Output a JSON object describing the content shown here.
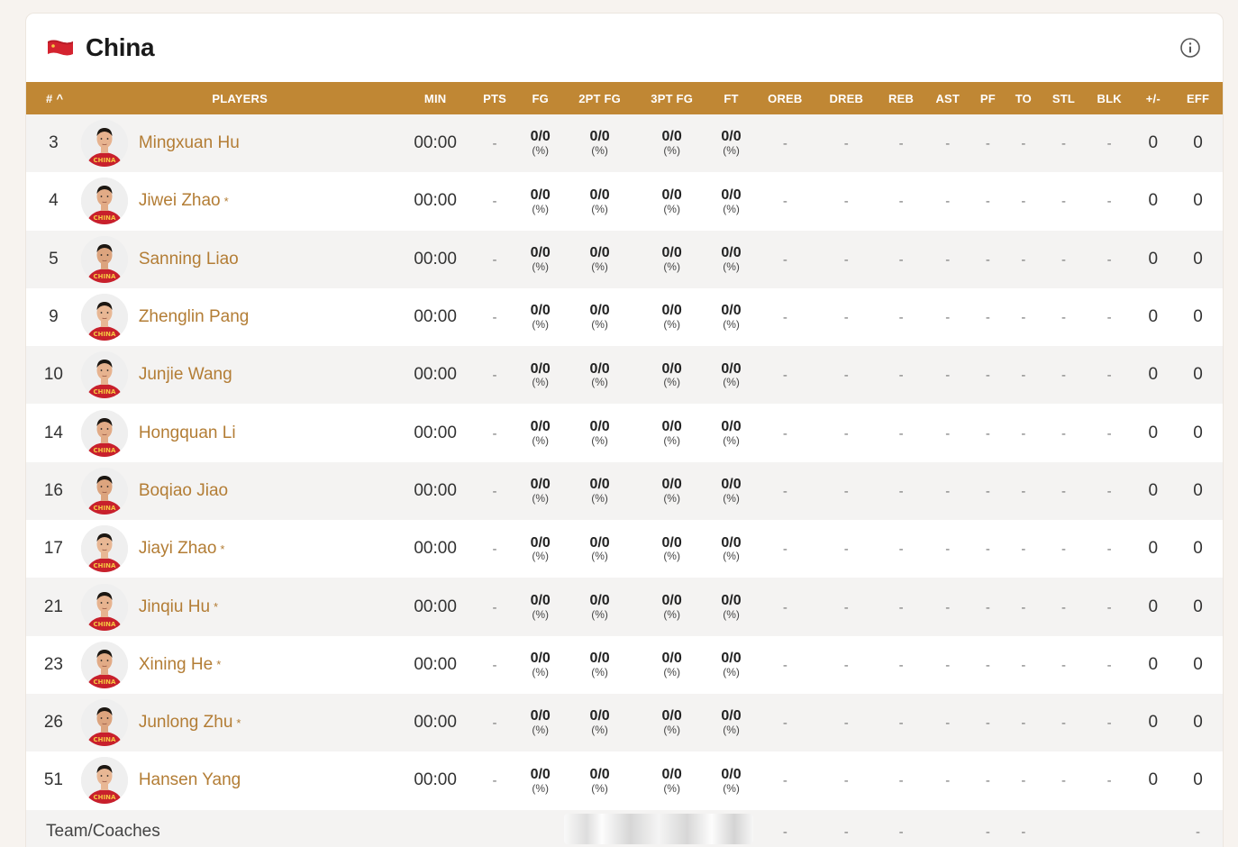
{
  "team": {
    "name": "China",
    "flag_color": "#d4232f",
    "flag_star_color": "#f5c842"
  },
  "columns": [
    "#",
    "PLAYERS",
    "MIN",
    "PTS",
    "FG",
    "2PT FG",
    "3PT FG",
    "FT",
    "OREB",
    "DREB",
    "REB",
    "AST",
    "PF",
    "TO",
    "STL",
    "BLK",
    "+/-",
    "EFF"
  ],
  "sort_indicator": "^",
  "players": [
    {
      "num": "3",
      "name": "Mingxuan Hu",
      "star": "",
      "min": "00:00",
      "pts": "-",
      "fg": "0/0",
      "fg_pct": "(%)",
      "fg2": "0/0",
      "fg2_pct": "(%)",
      "fg3": "0/0",
      "fg3_pct": "(%)",
      "ft": "0/0",
      "ft_pct": "(%)",
      "oreb": "-",
      "dreb": "-",
      "reb": "-",
      "ast": "-",
      "pf": "-",
      "to": "-",
      "stl": "-",
      "blk": "-",
      "pm": "0",
      "eff": "0"
    },
    {
      "num": "4",
      "name": "Jiwei Zhao",
      "star": "*",
      "min": "00:00",
      "pts": "-",
      "fg": "0/0",
      "fg_pct": "(%)",
      "fg2": "0/0",
      "fg2_pct": "(%)",
      "fg3": "0/0",
      "fg3_pct": "(%)",
      "ft": "0/0",
      "ft_pct": "(%)",
      "oreb": "-",
      "dreb": "-",
      "reb": "-",
      "ast": "-",
      "pf": "-",
      "to": "-",
      "stl": "-",
      "blk": "-",
      "pm": "0",
      "eff": "0"
    },
    {
      "num": "5",
      "name": "Sanning Liao",
      "star": "",
      "min": "00:00",
      "pts": "-",
      "fg": "0/0",
      "fg_pct": "(%)",
      "fg2": "0/0",
      "fg2_pct": "(%)",
      "fg3": "0/0",
      "fg3_pct": "(%)",
      "ft": "0/0",
      "ft_pct": "(%)",
      "oreb": "-",
      "dreb": "-",
      "reb": "-",
      "ast": "-",
      "pf": "-",
      "to": "-",
      "stl": "-",
      "blk": "-",
      "pm": "0",
      "eff": "0"
    },
    {
      "num": "9",
      "name": "Zhenglin Pang",
      "star": "",
      "min": "00:00",
      "pts": "-",
      "fg": "0/0",
      "fg_pct": "(%)",
      "fg2": "0/0",
      "fg2_pct": "(%)",
      "fg3": "0/0",
      "fg3_pct": "(%)",
      "ft": "0/0",
      "ft_pct": "(%)",
      "oreb": "-",
      "dreb": "-",
      "reb": "-",
      "ast": "-",
      "pf": "-",
      "to": "-",
      "stl": "-",
      "blk": "-",
      "pm": "0",
      "eff": "0"
    },
    {
      "num": "10",
      "name": "Junjie Wang",
      "star": "",
      "min": "00:00",
      "pts": "-",
      "fg": "0/0",
      "fg_pct": "(%)",
      "fg2": "0/0",
      "fg2_pct": "(%)",
      "fg3": "0/0",
      "fg3_pct": "(%)",
      "ft": "0/0",
      "ft_pct": "(%)",
      "oreb": "-",
      "dreb": "-",
      "reb": "-",
      "ast": "-",
      "pf": "-",
      "to": "-",
      "stl": "-",
      "blk": "-",
      "pm": "0",
      "eff": "0"
    },
    {
      "num": "14",
      "name": "Hongquan Li",
      "star": "",
      "min": "00:00",
      "pts": "-",
      "fg": "0/0",
      "fg_pct": "(%)",
      "fg2": "0/0",
      "fg2_pct": "(%)",
      "fg3": "0/0",
      "fg3_pct": "(%)",
      "ft": "0/0",
      "ft_pct": "(%)",
      "oreb": "-",
      "dreb": "-",
      "reb": "-",
      "ast": "-",
      "pf": "-",
      "to": "-",
      "stl": "-",
      "blk": "-",
      "pm": "0",
      "eff": "0"
    },
    {
      "num": "16",
      "name": "Boqiao Jiao",
      "star": "",
      "min": "00:00",
      "pts": "-",
      "fg": "0/0",
      "fg_pct": "(%)",
      "fg2": "0/0",
      "fg2_pct": "(%)",
      "fg3": "0/0",
      "fg3_pct": "(%)",
      "ft": "0/0",
      "ft_pct": "(%)",
      "oreb": "-",
      "dreb": "-",
      "reb": "-",
      "ast": "-",
      "pf": "-",
      "to": "-",
      "stl": "-",
      "blk": "-",
      "pm": "0",
      "eff": "0"
    },
    {
      "num": "17",
      "name": "Jiayi Zhao",
      "star": "*",
      "min": "00:00",
      "pts": "-",
      "fg": "0/0",
      "fg_pct": "(%)",
      "fg2": "0/0",
      "fg2_pct": "(%)",
      "fg3": "0/0",
      "fg3_pct": "(%)",
      "ft": "0/0",
      "ft_pct": "(%)",
      "oreb": "-",
      "dreb": "-",
      "reb": "-",
      "ast": "-",
      "pf": "-",
      "to": "-",
      "stl": "-",
      "blk": "-",
      "pm": "0",
      "eff": "0"
    },
    {
      "num": "21",
      "name": "Jinqiu Hu",
      "star": "*",
      "min": "00:00",
      "pts": "-",
      "fg": "0/0",
      "fg_pct": "(%)",
      "fg2": "0/0",
      "fg2_pct": "(%)",
      "fg3": "0/0",
      "fg3_pct": "(%)",
      "ft": "0/0",
      "ft_pct": "(%)",
      "oreb": "-",
      "dreb": "-",
      "reb": "-",
      "ast": "-",
      "pf": "-",
      "to": "-",
      "stl": "-",
      "blk": "-",
      "pm": "0",
      "eff": "0"
    },
    {
      "num": "23",
      "name": "Xining He",
      "star": "*",
      "min": "00:00",
      "pts": "-",
      "fg": "0/0",
      "fg_pct": "(%)",
      "fg2": "0/0",
      "fg2_pct": "(%)",
      "fg3": "0/0",
      "fg3_pct": "(%)",
      "ft": "0/0",
      "ft_pct": "(%)",
      "oreb": "-",
      "dreb": "-",
      "reb": "-",
      "ast": "-",
      "pf": "-",
      "to": "-",
      "stl": "-",
      "blk": "-",
      "pm": "0",
      "eff": "0"
    },
    {
      "num": "26",
      "name": "Junlong Zhu",
      "star": "*",
      "min": "00:00",
      "pts": "-",
      "fg": "0/0",
      "fg_pct": "(%)",
      "fg2": "0/0",
      "fg2_pct": "(%)",
      "fg3": "0/0",
      "fg3_pct": "(%)",
      "ft": "0/0",
      "ft_pct": "(%)",
      "oreb": "-",
      "dreb": "-",
      "reb": "-",
      "ast": "-",
      "pf": "-",
      "to": "-",
      "stl": "-",
      "blk": "-",
      "pm": "0",
      "eff": "0"
    },
    {
      "num": "51",
      "name": "Hansen Yang",
      "star": "",
      "min": "00:00",
      "pts": "-",
      "fg": "0/0",
      "fg_pct": "(%)",
      "fg2": "0/0",
      "fg2_pct": "(%)",
      "fg3": "0/0",
      "fg3_pct": "(%)",
      "ft": "0/0",
      "ft_pct": "(%)",
      "oreb": "-",
      "dreb": "-",
      "reb": "-",
      "ast": "-",
      "pf": "-",
      "to": "-",
      "stl": "-",
      "blk": "-",
      "pm": "0",
      "eff": "0"
    }
  ],
  "team_row": {
    "label": "Team/Coaches",
    "oreb": "-",
    "dreb": "-",
    "reb": "-",
    "ast": "",
    "pf": "-",
    "to": "-",
    "stl": "",
    "blk": "",
    "pm": "",
    "eff": "-"
  },
  "colors": {
    "header_bg": "#c08734",
    "player_name": "#b37d35",
    "jersey": "#c8202c",
    "jersey_text": "#f5c842"
  },
  "icons": {
    "info": "info-circle-icon",
    "flag": "china-flag-icon",
    "sort": "sort-asc-icon"
  }
}
